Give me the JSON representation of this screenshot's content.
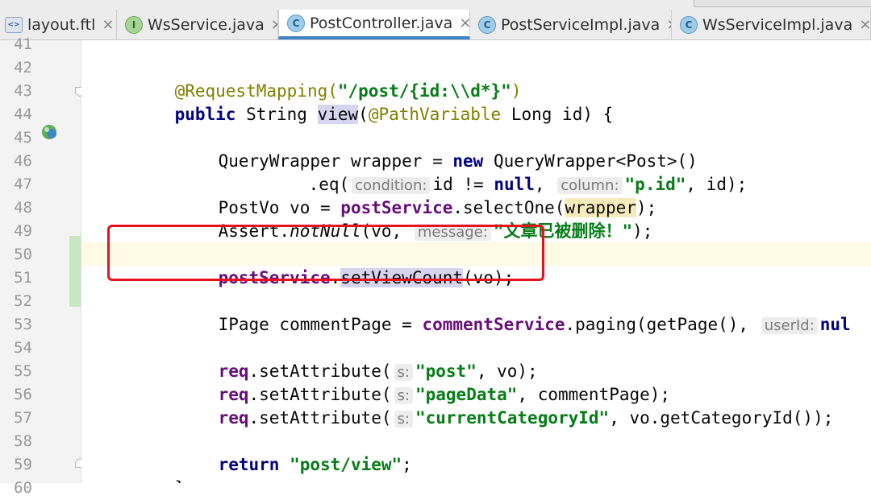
{
  "tabs": [
    {
      "label": "layout.ftl",
      "icon": "ftl-file-icon"
    },
    {
      "label": "WsService.java",
      "icon": "interface-icon"
    },
    {
      "label": "PostController.java",
      "icon": "class-icon",
      "active": true
    },
    {
      "label": "PostServiceImpl.java",
      "icon": "class-icon"
    },
    {
      "label": "WsServiceImpl.java",
      "icon": "class-icon"
    }
  ],
  "line_numbers": [
    "41",
    "42",
    "43",
    "44",
    "45",
    "46",
    "47",
    "48",
    "49",
    "50",
    "51",
    "52",
    "53",
    "54",
    "55",
    "56",
    "57",
    "58",
    "59",
    "60"
  ],
  "code": {
    "l42": {
      "ann": "@RequestMapping(",
      "str": "\"/post/{id:\\\\d*}\"",
      "end": ")"
    },
    "l43": {
      "kw": "public",
      "t1": " String ",
      "method": "view",
      "t2": "(",
      "ann": "@PathVariable",
      "t3": " Long id) {"
    },
    "l45": {
      "t1": "QueryWrapper wrapper = ",
      "kw": "new",
      "t2": " QueryWrapper<Post>()"
    },
    "l46": {
      "t1": ".eq(",
      "hint1": "condition:",
      "t2": "id != ",
      "kw": "null",
      "t3": ",",
      "hint2": "column:",
      "str": "\"p.id\"",
      "t4": ", id);"
    },
    "l47": {
      "t1": "PostVo vo = ",
      "fld": "postService",
      "t2": ".selectOne(",
      "arg": "wrapper",
      "t3": ");"
    },
    "l48": {
      "t1": "Assert.",
      "ital": "notNull",
      "t2": "(vo,",
      "hint": "message:",
      "str": "\"文章已被删除！\"",
      "t3": ");"
    },
    "l50": {
      "fld": "postService",
      "t1": ".",
      "method": "setViewCount",
      "t2": "(vo);"
    },
    "l52": {
      "t1": "IPage commentPage = ",
      "fld": "commentService",
      "t2": ".paging(getPage(),",
      "hint": "userId:",
      "kw": "nul"
    },
    "l54": {
      "fld": "req",
      "t1": ".setAttribute(",
      "hint": "s:",
      "str": "\"post\"",
      "t2": ", vo);"
    },
    "l55": {
      "fld": "req",
      "t1": ".setAttribute(",
      "hint": "s:",
      "str": "\"pageData\"",
      "t2": ", commentPage);"
    },
    "l56": {
      "fld": "req",
      "t1": ".setAttribute(",
      "hint": "s:",
      "str": "\"currentCategoryId\"",
      "t2": ", vo.getCategoryId());"
    },
    "l58": {
      "kw": "return",
      "t1": " ",
      "str": "\"post/view\"",
      "t2": ";"
    },
    "l59": {
      "t1": "}"
    }
  },
  "colors": {
    "annotation_box": "#e8121c",
    "active_tab_underline": "#4083c9"
  }
}
